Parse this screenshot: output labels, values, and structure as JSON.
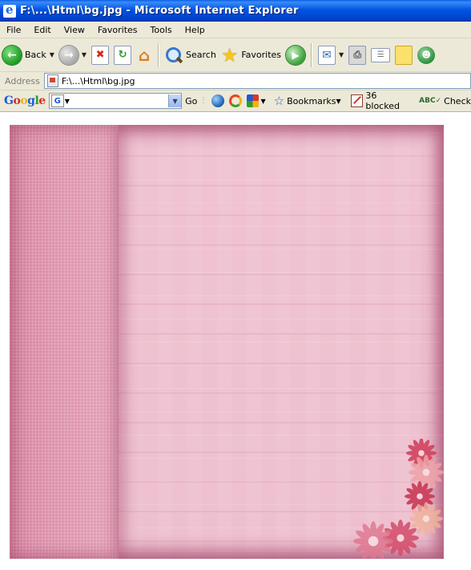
{
  "window": {
    "title": "F:\\...\\Html\\bg.jpg - Microsoft Internet Explorer"
  },
  "menu": {
    "items": [
      "File",
      "Edit",
      "View",
      "Favorites",
      "Tools",
      "Help"
    ]
  },
  "toolbar": {
    "back_label": "Back",
    "search_label": "Search",
    "favorites_label": "Favorites"
  },
  "address": {
    "label": "Address",
    "value": "F:\\...\\Html\\bg.jpg"
  },
  "google_toolbar": {
    "logo": "Google",
    "search_value": "",
    "go_label": "Go",
    "bookmarks_label": "Bookmarks",
    "blocked_label": "36 blocked",
    "check_label": "Check"
  },
  "content": {
    "colors": {
      "background": "#efc2d1",
      "stripe_panel": "#dc8fa9",
      "border_shade": "#a8527a"
    }
  }
}
